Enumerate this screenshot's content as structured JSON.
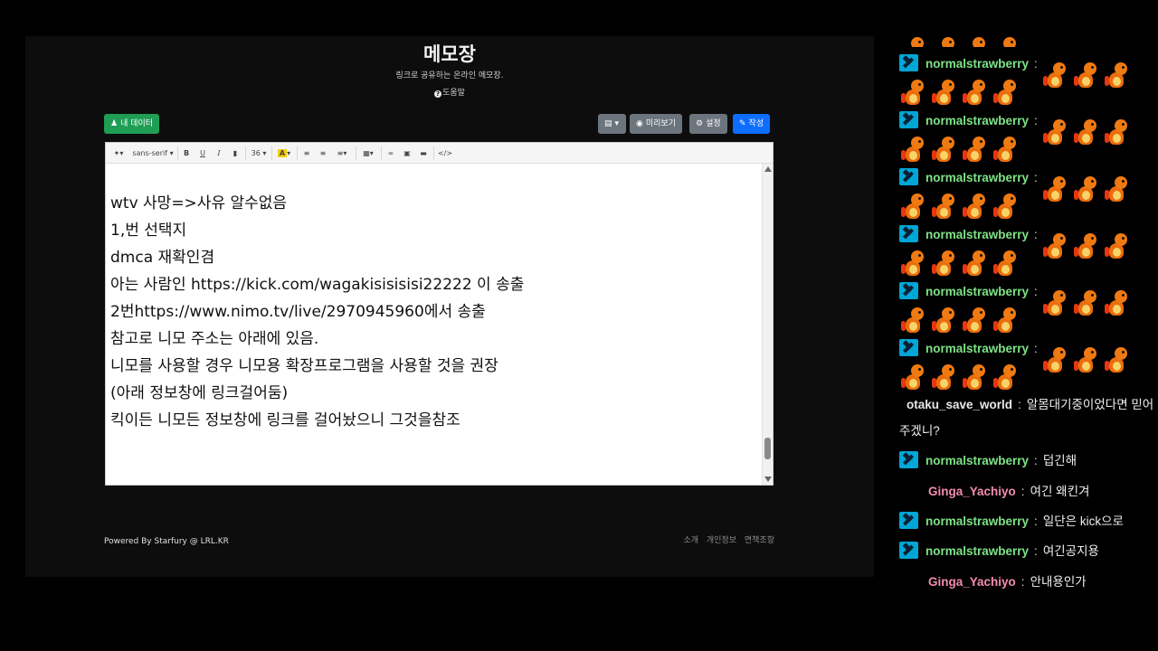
{
  "memo": {
    "title": "메모장",
    "subtitle": "링크로 공유하는 온라인 메모장.",
    "help": "도움말",
    "buttons": {
      "my_data": "내 데이터",
      "preview": "미리보기",
      "settings": "설정",
      "write": "작성"
    },
    "toolbar": {
      "font_family": "sans-serif",
      "font_size": "36",
      "bold": "B",
      "underline": "U",
      "italic": "I",
      "code": "</>"
    },
    "content_lines": [
      "wtv 사망=>사유 알수없음",
      "1,번 선택지",
      "dmca 재확인겸",
      "아는 사람인 https://kick.com/wagakisisisisi22222 이 송출",
      "2번https://www.nimo.tv/live/2970945960에서 송출",
      "참고로 니모 주소는 아래에 있음.",
      "니모를 사용할 경우 니모용 확장프로그램을 사용할 것을 권장",
      "(아래 정보창에 링크걸어둠)",
      "킥이든 니모든 정보창에 링크를 걸어놨으니 그것을참조"
    ],
    "footer": {
      "powered_by": "Powered By Starfury @ LRL.KR",
      "links": [
        "소개",
        "개인정보",
        "면책조항"
      ]
    }
  },
  "chat": {
    "emote_name": "charmander-emote",
    "messages": [
      {
        "user": "normalstrawberry",
        "text": "",
        "badge": true
      },
      {
        "user": "normalstrawberry",
        "text": "",
        "badge": true
      },
      {
        "user": "normalstrawberry",
        "text": "",
        "badge": true
      },
      {
        "user": "normalstrawberry",
        "text": "",
        "badge": true
      },
      {
        "user": "normalstrawberry",
        "text": "",
        "badge": true
      },
      {
        "user": "normalstrawberry",
        "text": "",
        "badge": true
      },
      {
        "user": "otaku_save_world",
        "text": "알몸대기중이었다면 믿어",
        "text_cont": "주겠니?",
        "badge": false
      },
      {
        "user": "normalstrawberry",
        "text": "덥긴해",
        "badge": true
      },
      {
        "user": "Ginga_Yachiyo",
        "text": "여긴 왜킨겨",
        "badge": false
      },
      {
        "user": "normalstrawberry",
        "text": "일단은 kick으로",
        "badge": true
      },
      {
        "user": "normalstrawberry",
        "text": "여긴공지용",
        "badge": true
      },
      {
        "user": "Ginga_Yachiyo",
        "text": "안내용인가",
        "badge": false
      }
    ],
    "colors": {
      "normalstrawberry": "#7ee287",
      "otaku_save_world": "#e8e8e8",
      "Ginga_Yachiyo": "#f28dad",
      "badge": "#00a6d6"
    }
  }
}
